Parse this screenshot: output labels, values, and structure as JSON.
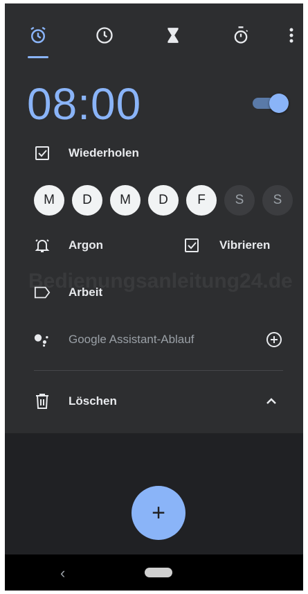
{
  "tabs": [
    {
      "name": "alarm-icon",
      "active": true
    },
    {
      "name": "clock-icon",
      "active": false
    },
    {
      "name": "timer-icon",
      "active": false
    },
    {
      "name": "stopwatch-icon",
      "active": false
    }
  ],
  "alarm": {
    "time": "08:00",
    "enabled": true,
    "repeat_label": "Wiederholen",
    "repeat_checked": true,
    "days": [
      {
        "label": "M",
        "selected": true
      },
      {
        "label": "D",
        "selected": true
      },
      {
        "label": "M",
        "selected": true
      },
      {
        "label": "D",
        "selected": true
      },
      {
        "label": "F",
        "selected": true
      },
      {
        "label": "S",
        "selected": false
      },
      {
        "label": "S",
        "selected": false
      }
    ],
    "ringtone_label": "Argon",
    "vibrate_label": "Vibrieren",
    "vibrate_checked": true,
    "alarm_label": "Arbeit",
    "assistant_label": "Google Assistant-Ablauf",
    "delete_label": "Löschen"
  },
  "watermark": "Bedienungsanleitung24.de",
  "fab": {
    "icon": "add-icon",
    "label": "+"
  },
  "navbar": {
    "back_glyph": "‹"
  },
  "colors": {
    "accent": "#8ab4f8",
    "background": "#202124",
    "card": "#2d2e30"
  }
}
